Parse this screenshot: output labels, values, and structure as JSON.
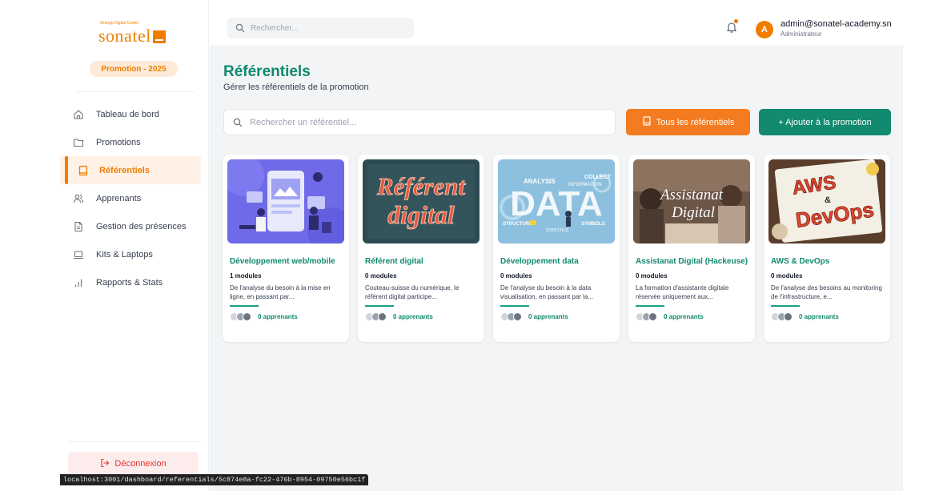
{
  "sidebar": {
    "logo": {
      "tagline": "Orange Digital Center",
      "wordmark": "sonatel"
    },
    "promotion_badge": "Promotion - 2025",
    "items": [
      {
        "label": "Tableau de bord",
        "icon": "home-icon",
        "active": false
      },
      {
        "label": "Promotions",
        "icon": "folder-icon",
        "active": false
      },
      {
        "label": "Référentiels",
        "icon": "book-icon",
        "active": true
      },
      {
        "label": "Apprenants",
        "icon": "users-icon",
        "active": false
      },
      {
        "label": "Gestion des présences",
        "icon": "file-icon",
        "active": false
      },
      {
        "label": "Kits & Laptops",
        "icon": "laptop-icon",
        "active": false
      },
      {
        "label": "Rapports & Stats",
        "icon": "bar-chart-icon",
        "active": false
      }
    ],
    "logout_label": "Déconnexion"
  },
  "topbar": {
    "search_placeholder": "Rechercher...",
    "user_email": "admin@sonatel-academy.sn",
    "user_role": "Administrateur",
    "avatar_initial": "A"
  },
  "page": {
    "title": "Référentiels",
    "subtitle": "Gérer les référentiels de la promotion",
    "search_placeholder": "Rechercher un référentiel...",
    "all_button": "Tous les référentiels",
    "add_button": "+ Ajouter à la promotion"
  },
  "cards": [
    {
      "title": "Développement web/mobile",
      "modules": "1 modules",
      "description": "De l'analyse du besoin à la mise en ligne, en passant par...",
      "learners": "0 apprenants"
    },
    {
      "title": "Référent digital",
      "modules": "0 modules",
      "description": "Couteau-suisse du numérique, le référent digital participe...",
      "learners": "0 apprenants",
      "image_text": [
        "Référent",
        "digital"
      ]
    },
    {
      "title": "Développement data",
      "modules": "0 modules",
      "description": "De l'analyse du besoin à la data visualisation, en passant par la...",
      "learners": "0 apprenants",
      "image_text": [
        "DATA",
        "ANALYSIS",
        "COLLECT",
        "INFORMATION",
        "STRUCTURE",
        "SYMBOLS",
        "STATISTICS"
      ]
    },
    {
      "title": "Assistanat Digital (Hackeuse)",
      "modules": "0 modules",
      "description": "La formation d'assistante digitale réservée uniquement aux...",
      "learners": "0 apprenants",
      "image_text": [
        "Assistanat",
        "Digital"
      ]
    },
    {
      "title": "AWS & DevOps",
      "modules": "0 modules",
      "description": "De l'analyse des besoins au monitoring de l'infrastructure, e...",
      "learners": "0 apprenants",
      "image_text": [
        "AWS",
        "&",
        "DevOps"
      ]
    }
  ],
  "statusbar": "localhost:3001/dashboard/referentials/5c874e8a-fc22-476b-8954-09750e56bc1f",
  "colors": {
    "brand_orange": "#f07d00",
    "brand_green": "#0f8a6e",
    "button_green": "#118a6f",
    "button_orange": "#f47b20"
  }
}
